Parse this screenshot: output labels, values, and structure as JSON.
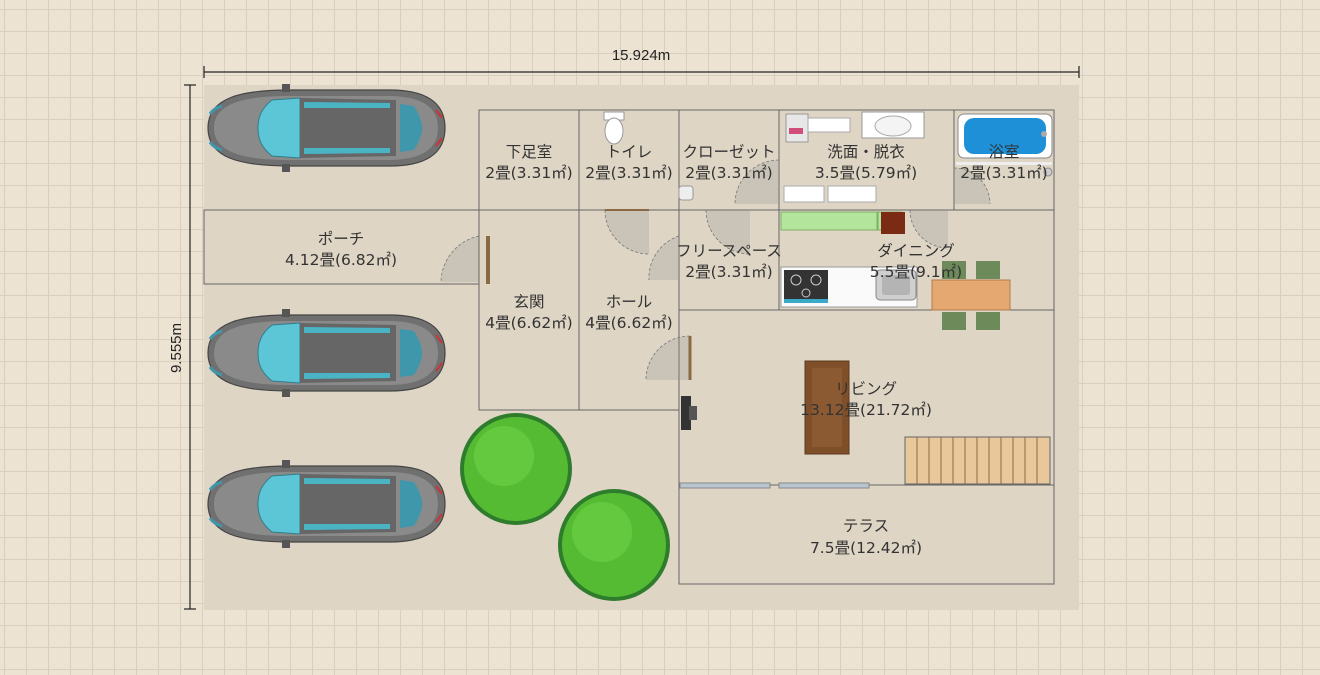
{
  "dimensions": {
    "width": "15.924m",
    "height": "9.555m"
  },
  "rooms": [
    {
      "id": "geshoku",
      "name": "下足室",
      "size": "2畳(3.31㎡)"
    },
    {
      "id": "toilet",
      "name": "トイレ",
      "size": "2畳(3.31㎡)"
    },
    {
      "id": "closet",
      "name": "クローゼット",
      "size": "2畳(3.31㎡)"
    },
    {
      "id": "senmen",
      "name": "洗面・脱衣",
      "size": "3.5畳(5.79㎡)"
    },
    {
      "id": "yokushitsu",
      "name": "浴室",
      "size": "2畳(3.31㎡)"
    },
    {
      "id": "porch",
      "name": "ポーチ",
      "size": "4.12畳(6.82㎡)"
    },
    {
      "id": "free",
      "name": "フリースペース",
      "size": "2畳(3.31㎡)"
    },
    {
      "id": "dining",
      "name": "ダイニング",
      "size": "5.5畳(9.1㎡)"
    },
    {
      "id": "genkan",
      "name": "玄関",
      "size": "4畳(6.62㎡)"
    },
    {
      "id": "hall",
      "name": "ホール",
      "size": "4畳(6.62㎡)"
    },
    {
      "id": "living",
      "name": "リビング",
      "size": "13.12畳(21.72㎡)"
    },
    {
      "id": "terrace",
      "name": "テラス",
      "size": "7.5畳(12.42㎡)"
    }
  ],
  "colors": {
    "lot": "#ded5c4",
    "wood": "#b6754c",
    "living_floor": "#b48063",
    "terrace": "#e6ebd2",
    "tree": "#55bb33",
    "car_glass": "#5cc6d6"
  }
}
